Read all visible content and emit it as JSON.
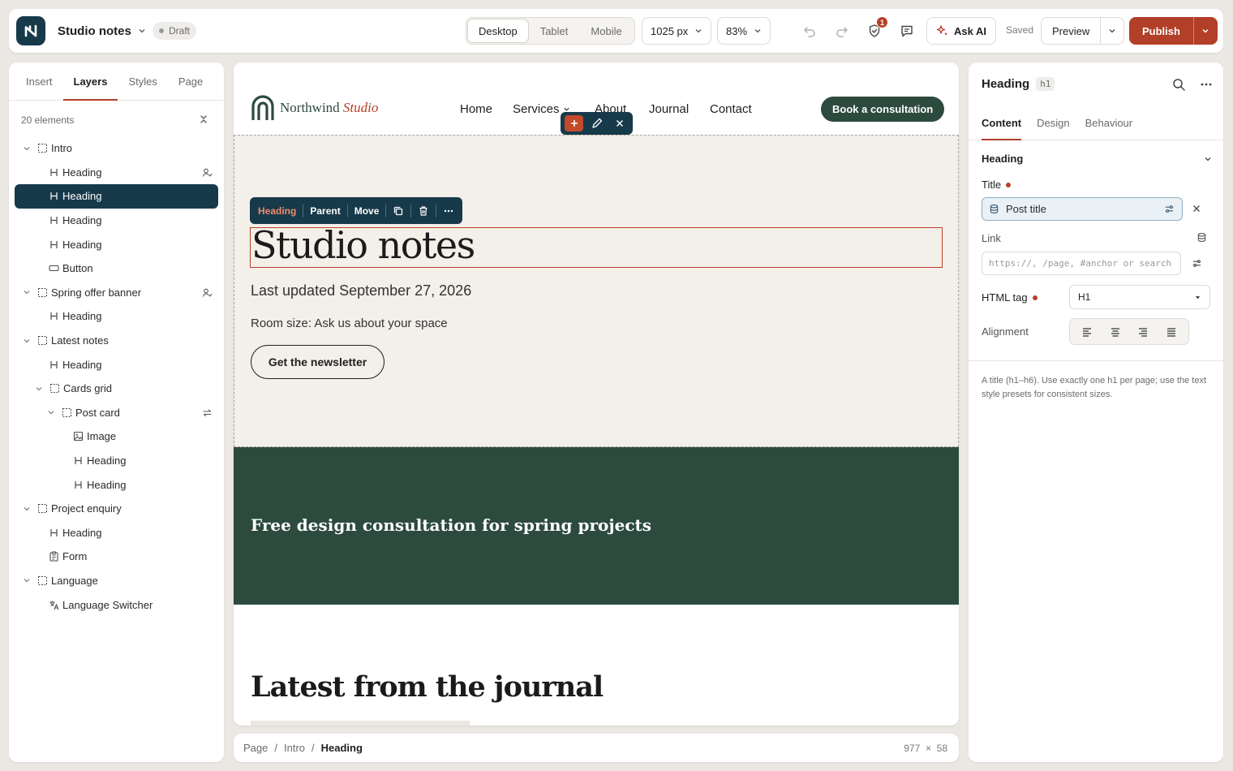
{
  "app": {
    "title": "Studio notes",
    "status": "Draft"
  },
  "toolbar": {
    "devices": [
      "Desktop",
      "Tablet",
      "Mobile"
    ],
    "width": "1025 px",
    "zoom": "83%",
    "notifications_count": "1",
    "ask_ai": "Ask AI",
    "saved": "Saved",
    "preview": "Preview",
    "publish": "Publish"
  },
  "left_panel": {
    "tabs": [
      "Insert",
      "Layers",
      "Styles",
      "Page"
    ],
    "element_count": "20 elements",
    "layers": [
      {
        "label": "Intro",
        "depth": 0,
        "type": "container",
        "expanded": true
      },
      {
        "label": "Heading",
        "depth": 1,
        "type": "heading",
        "extra": "user"
      },
      {
        "label": "Heading",
        "depth": 1,
        "type": "heading",
        "selected": true
      },
      {
        "label": "Heading",
        "depth": 1,
        "type": "heading"
      },
      {
        "label": "Heading",
        "depth": 1,
        "type": "heading"
      },
      {
        "label": "Button",
        "depth": 1,
        "type": "button"
      },
      {
        "label": "Spring offer banner",
        "depth": 0,
        "type": "container",
        "expanded": true,
        "extra": "user"
      },
      {
        "label": "Heading",
        "depth": 1,
        "type": "heading"
      },
      {
        "label": "Latest notes",
        "depth": 0,
        "type": "container",
        "expanded": true
      },
      {
        "label": "Heading",
        "depth": 1,
        "type": "heading"
      },
      {
        "label": "Cards grid",
        "depth": 1,
        "type": "container",
        "expanded": true
      },
      {
        "label": "Post card",
        "depth": 2,
        "type": "container",
        "expanded": true,
        "extra": "loop"
      },
      {
        "label": "Image",
        "depth": 3,
        "type": "image"
      },
      {
        "label": "Heading",
        "depth": 3,
        "type": "heading"
      },
      {
        "label": "Heading",
        "depth": 3,
        "type": "heading"
      },
      {
        "label": "Project enquiry",
        "depth": 0,
        "type": "container",
        "expanded": true
      },
      {
        "label": "Heading",
        "depth": 1,
        "type": "heading"
      },
      {
        "label": "Form",
        "depth": 1,
        "type": "form"
      },
      {
        "label": "Language",
        "depth": 0,
        "type": "container",
        "expanded": true
      },
      {
        "label": "Language Switcher",
        "depth": 1,
        "type": "language"
      }
    ]
  },
  "canvas": {
    "brand_name": "Northwind",
    "brand_accent": "Studio",
    "nav": [
      "Home",
      "Services",
      "About",
      "Journal",
      "Contact"
    ],
    "cta": "Book a consultation",
    "element_toolbar": {
      "type": "Heading",
      "parent": "Parent",
      "move": "Move"
    },
    "hero_title": "Studio notes",
    "updated": "Last updated September 27, 2026",
    "room": "Room size: Ask us about your space",
    "newsletter": "Get the newsletter",
    "banner_text": "Free design consultation for spring projects",
    "latest_title": "Latest from the journal"
  },
  "breadcrumb": {
    "items": [
      "Page",
      "Intro",
      "Heading"
    ],
    "width": "977",
    "times": "×",
    "height": "58"
  },
  "right_panel": {
    "title": "Heading",
    "tag": "h1",
    "tabs": [
      "Content",
      "Design",
      "Behaviour"
    ],
    "section": "Heading",
    "title_label": "Title",
    "title_value": "Post title",
    "link_label": "Link",
    "link_placeholder": "https://, /page, #anchor or search",
    "html_tag_label": "HTML tag",
    "html_tag_value": "H1",
    "alignment_label": "Alignment",
    "help": "A title (h1–h6). Use exactly one h1 per page; use the text style presets for consistent sizes."
  },
  "colors": {
    "accent": "#b23f27",
    "navy": "#173a4a",
    "forest": "#2d4a3e",
    "cream": "#f3efe9"
  }
}
